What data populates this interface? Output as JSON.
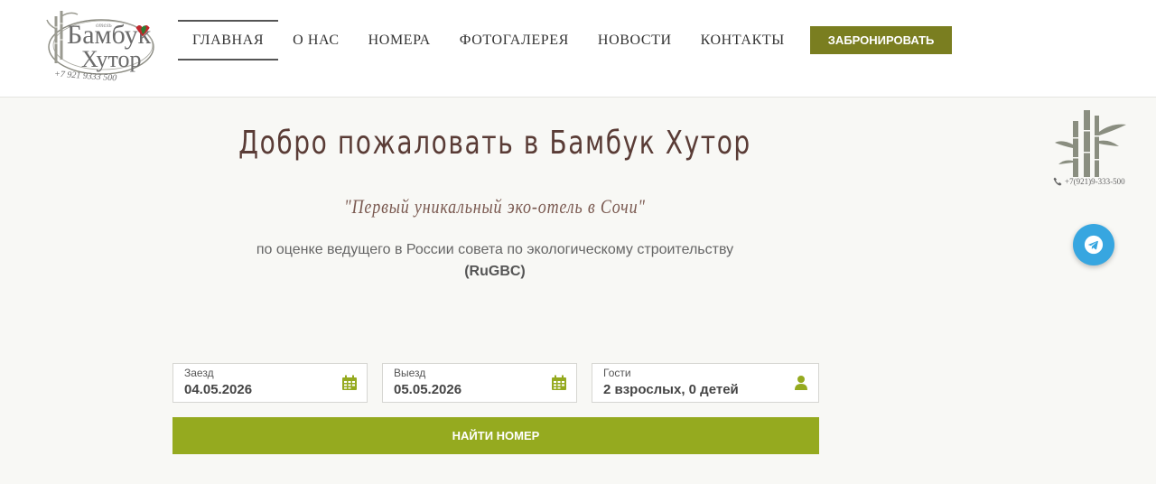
{
  "header": {
    "logo": {
      "text_top": "Бамбук",
      "text_bottom": "Хутор",
      "small": "отель",
      "phone": "+7 921 9333 500"
    },
    "nav": [
      {
        "label": "ГЛАВНАЯ",
        "active": true
      },
      {
        "label": "О НАС"
      },
      {
        "label": "НОМЕРА"
      },
      {
        "label": "ФОТОГАЛЕРЕЯ"
      },
      {
        "label": "НОВОСТИ"
      },
      {
        "label": "КОНТАКТЫ"
      }
    ],
    "book_label": "ЗАБРОНИРОВАТЬ"
  },
  "hero": {
    "title": "Добро пожаловать в Бамбук Хутор",
    "subtitle": "\"Первый уникальный эко-отель в Сочи\"",
    "desc_line1": "по оценке ведущего в России совета по экологическому строительству",
    "desc_line2": "(RuGBC)"
  },
  "booking": {
    "checkin": {
      "label": "Заезд",
      "value": "04.05.2026"
    },
    "checkout": {
      "label": "Выезд",
      "value": "05.05.2026"
    },
    "guests": {
      "label": "Гости",
      "value": "2 взрослых, 0 детей"
    },
    "search_label": "НАЙТИ НОМЕР"
  },
  "side": {
    "phone": "+7(921)9-333-500"
  },
  "colors": {
    "accent": "#7a7e20",
    "button": "#95aa1f",
    "title": "#5a3c36",
    "icon": "#95aa1f",
    "telegram": "#37a6e0"
  }
}
